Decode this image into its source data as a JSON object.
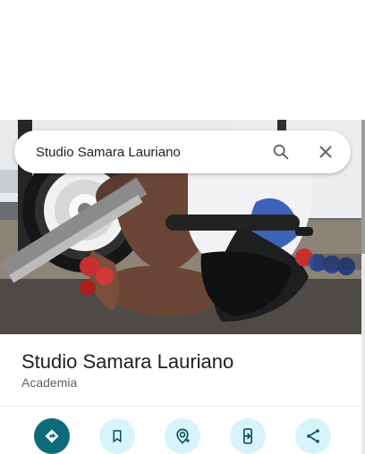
{
  "search": {
    "query": "Studio Samara Lauriano"
  },
  "place": {
    "name": "Studio Samara Lauriano",
    "category": "Academia"
  },
  "icons": {
    "search": "search-icon",
    "close": "close-icon",
    "directions": "directions-icon",
    "save": "bookmark-icon",
    "nearby": "nearby-icon",
    "send_to_phone": "send-to-phone-icon",
    "share": "share-icon"
  },
  "colors": {
    "primary_action": "#0c6b78",
    "secondary_action_bg": "#d7f4fb",
    "secondary_action_icon": "#0b4f5a",
    "title": "#1f1f1f",
    "category": "#5f6368"
  }
}
